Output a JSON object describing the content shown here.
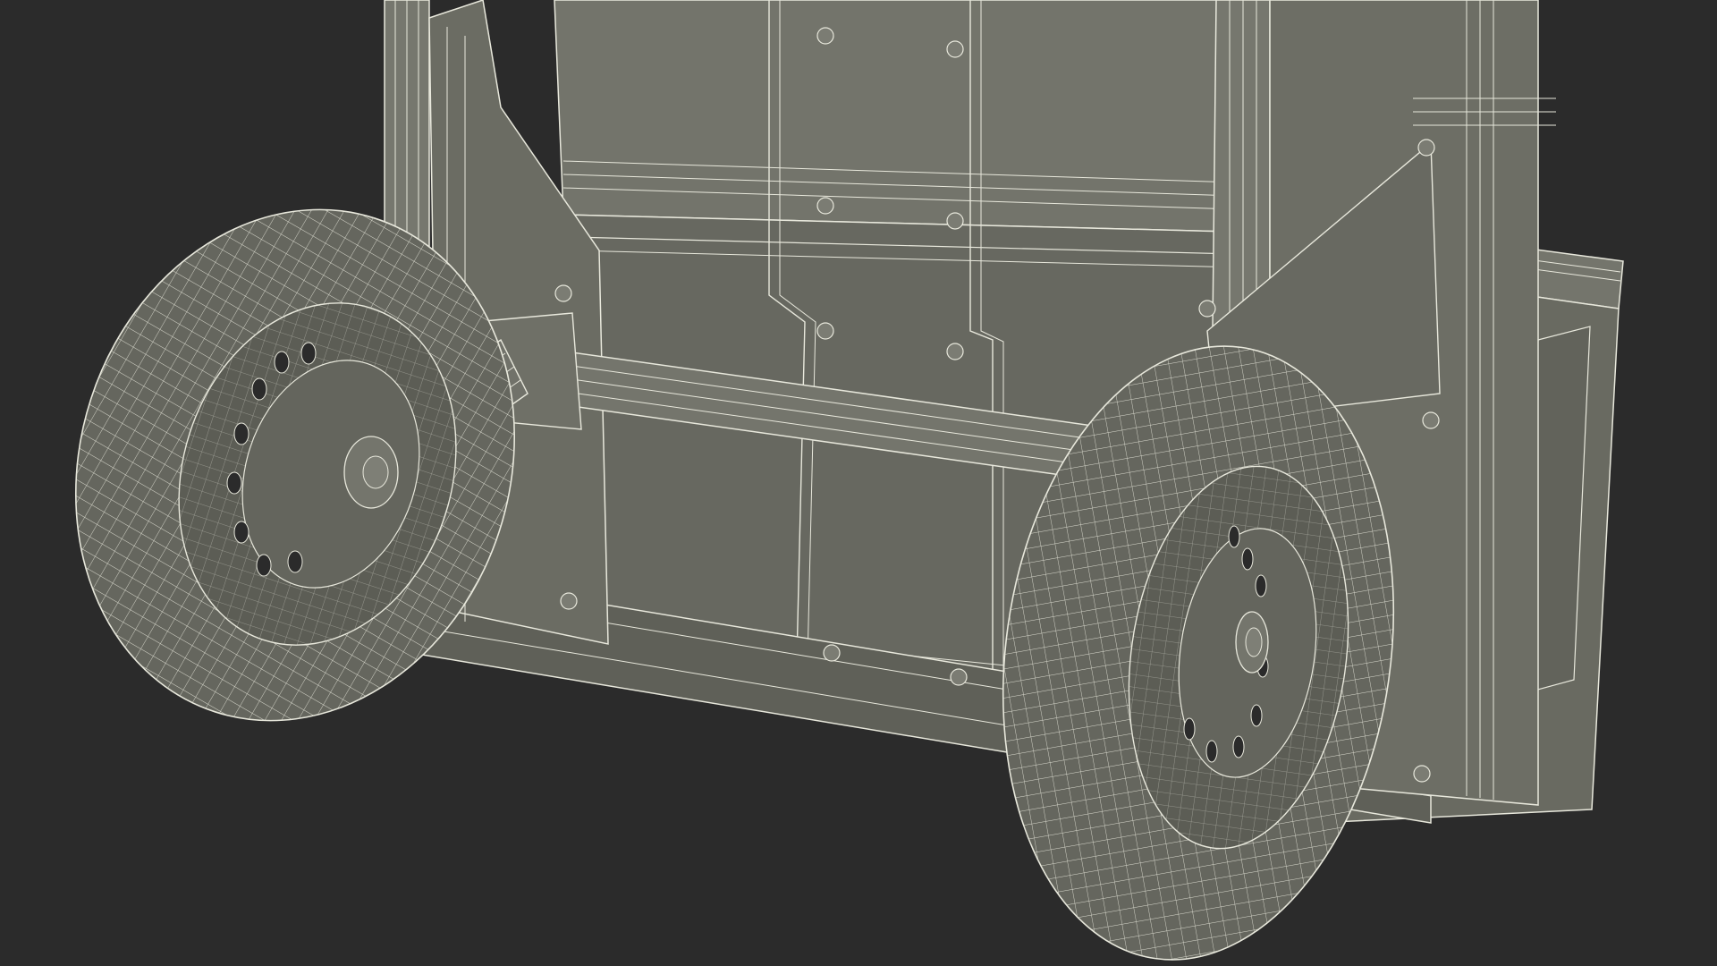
{
  "scene": {
    "background": "#2b2b2b",
    "surface_fill": "#6e6f66",
    "surface_fill_dark": "#5d5e56",
    "wire_color": "#e8e8dc"
  }
}
